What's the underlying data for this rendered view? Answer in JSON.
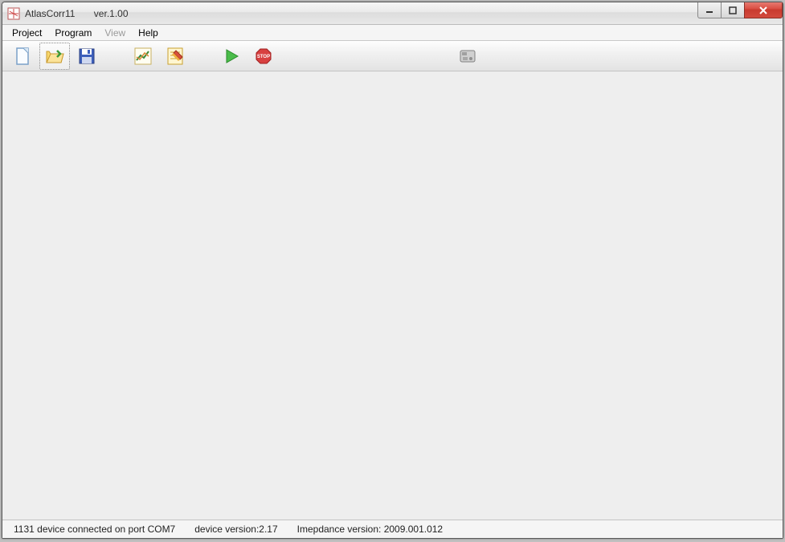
{
  "title": "AtlasCorr11       ver.1.00",
  "menu": {
    "project": "Project",
    "program": "Program",
    "view": "View",
    "help": "Help"
  },
  "toolbar": {
    "new": "New",
    "open": "Open",
    "save": "Save",
    "chart": "Chart",
    "notes": "Notes",
    "run": "Run",
    "stop": "Stop",
    "device": "Device"
  },
  "status": {
    "connection": "1131 device connected on port COM7",
    "device_version": "device version:2.17",
    "impedance_version": "Imepdance version: 2009.001.012"
  }
}
